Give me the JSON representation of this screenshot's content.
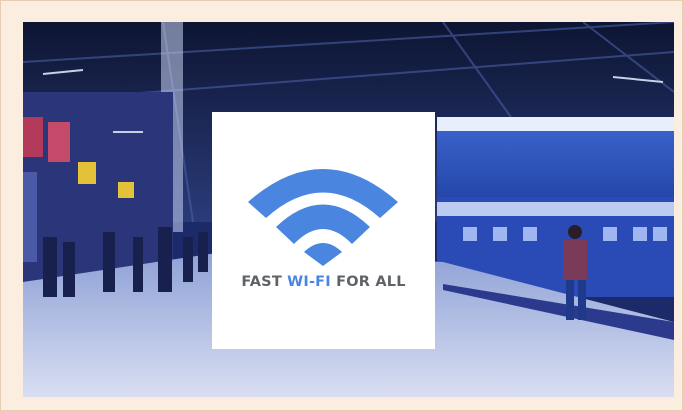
{
  "caption": {
    "part1": "FAST ",
    "part2": "WI-FI",
    "part3": " FOR ALL"
  },
  "colors": {
    "wifi_blue": "#4a86e0",
    "caption_gray": "#5f6368",
    "frame_bg": "#fbeee0",
    "card_bg": "#ffffff"
  },
  "icons": {
    "wifi": "wifi-icon"
  }
}
